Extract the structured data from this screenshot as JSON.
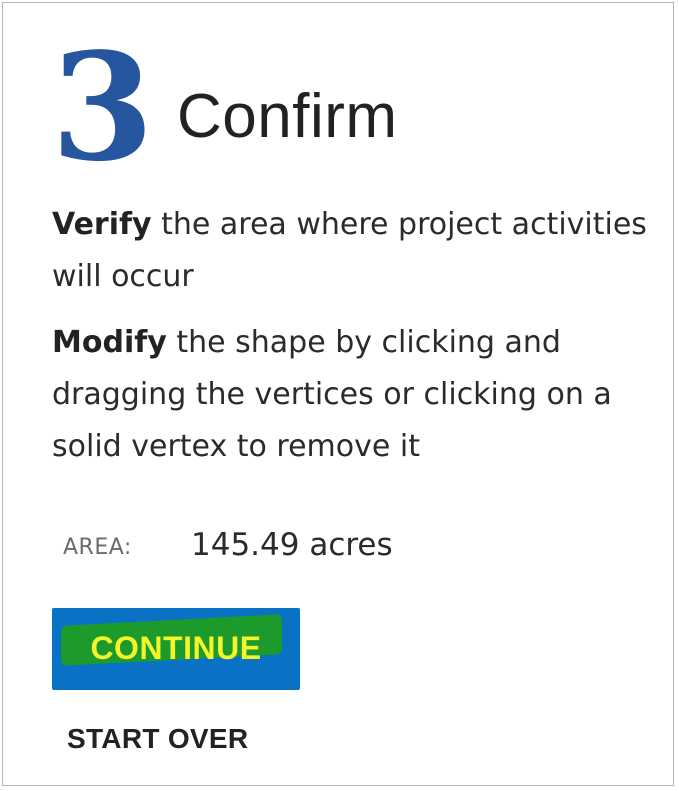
{
  "step": {
    "number": "3",
    "title": "Confirm"
  },
  "instructions": {
    "verify": {
      "keyword": "Verify",
      "text": " the area where project activities will occur"
    },
    "modify": {
      "keyword": "Modify",
      "text": " the shape by clicking and dragging the vertices or clicking on a solid vertex to remove it"
    }
  },
  "area": {
    "label": "AREA:",
    "value": "145.49 acres"
  },
  "actions": {
    "continue_label": "CONTINUE",
    "start_over_label": "START OVER"
  },
  "colors": {
    "step_number": "#26569e",
    "continue_bg": "#0a72c5",
    "continue_highlight": "#1d9a2c",
    "continue_text": "#f3f42a"
  }
}
